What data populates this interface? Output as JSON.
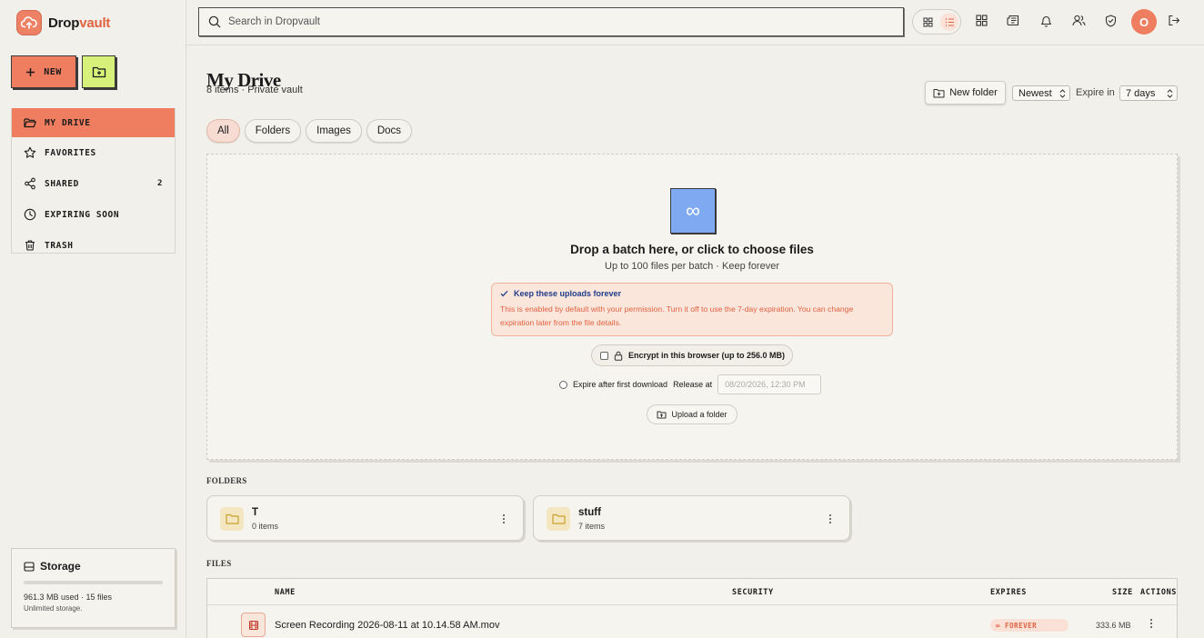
{
  "app": {
    "brand_prefix": "Drop",
    "brand_suffix": "vault"
  },
  "sidebar": {
    "new_label": "NEW",
    "items": [
      {
        "label": "MY DRIVE",
        "count": ""
      },
      {
        "label": "FAVORITES",
        "count": ""
      },
      {
        "label": "SHARED",
        "count": "2"
      },
      {
        "label": "EXPIRING SOON",
        "count": ""
      },
      {
        "label": "TRASH",
        "count": ""
      }
    ],
    "storage": {
      "title": "Storage",
      "used_text": "961.3 MB used · 15 files",
      "note": "Unlimited storage.",
      "fill_fraction": 0.0
    }
  },
  "topbar": {
    "search_placeholder": "Search in Dropvault",
    "avatar_initial": "O"
  },
  "main": {
    "title": "My Drive",
    "subtitle": "8 items · Private vault",
    "new_folder_label": "New folder",
    "sort_value": "Newest",
    "expire_label": "Expire in",
    "expire_value": "7 days",
    "filters": [
      "All",
      "Folders",
      "Images",
      "Docs"
    ],
    "dropzone": {
      "icon": "∞",
      "title": "Drop a batch here, or click to choose files",
      "subtitle": "Up to 100 files per batch · Keep forever",
      "keep_title": "Keep these uploads forever",
      "keep_body": "This is enabled by default with your permission. Turn it off to use the 7-day expiration. You can change expiration later from the file details.",
      "encrypt_label": "Encrypt in this browser (up to 256.0 MB)",
      "expire_first_label": "Expire after first download",
      "release_label": "Release at",
      "release_placeholder": "08/20/2026, 12:30 PM",
      "upload_folder_label": "Upload a folder"
    },
    "folders_label": "FOLDERS",
    "folders": [
      {
        "name": "T",
        "count": "0 items"
      },
      {
        "name": "stuff",
        "count": "7 items"
      }
    ],
    "files_label": "FILES",
    "files_headers": {
      "name": "NAME",
      "security": "SECURITY",
      "expires": "EXPIRES",
      "size": "SIZE",
      "actions": "ACTIONS"
    },
    "files": [
      {
        "name": "Screen Recording 2026-08-11 at 10.14.58 AM.mov",
        "expires": "∞ FOREVER",
        "size": "333.6 MB"
      }
    ]
  },
  "colors": {
    "accent": "#ef7d5f",
    "lime": "#d6f07a",
    "blue": "#7fa9f0",
    "background": "#f1f0ea"
  }
}
